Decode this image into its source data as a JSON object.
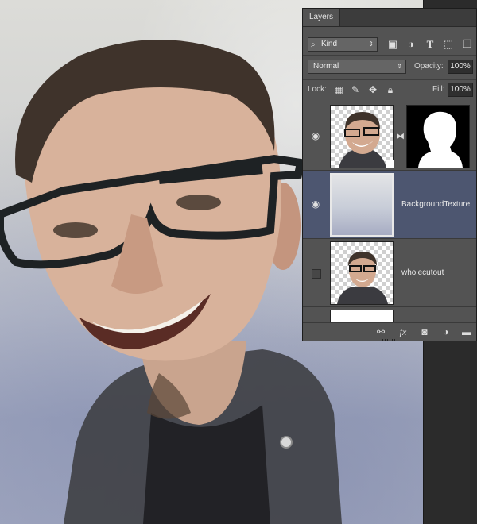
{
  "panel": {
    "tab_label": "Layers",
    "filter": {
      "selected": "Kind",
      "filter_icons": [
        "image-filter-icon",
        "adjustment-filter-icon",
        "type-filter-icon",
        "shape-filter-icon",
        "smart-object-filter-icon"
      ]
    },
    "blend_mode": "Normal",
    "opacity_label": "Opacity:",
    "opacity_value": "100%",
    "lock_label": "Lock:",
    "fill_label": "Fill:",
    "fill_value": "100%",
    "layers": [
      {
        "name": "",
        "visible": true,
        "selected": false,
        "has_mask": true,
        "smart_object": true
      },
      {
        "name": "BackgroundTexture",
        "visible": true,
        "selected": true,
        "has_mask": false
      },
      {
        "name": "wholecutout",
        "visible": false,
        "selected": false,
        "has_mask": false
      },
      {
        "name": "",
        "visible": false,
        "selected": false,
        "partial": true
      }
    ],
    "bottom_icons": [
      "link-layers-icon",
      "fx-icon",
      "add-mask-icon",
      "adjustment-layer-icon",
      "new-group-icon"
    ]
  },
  "colors": {
    "panel_bg": "#535353",
    "selected_row": "#4d5670",
    "workspace": "#282828"
  }
}
